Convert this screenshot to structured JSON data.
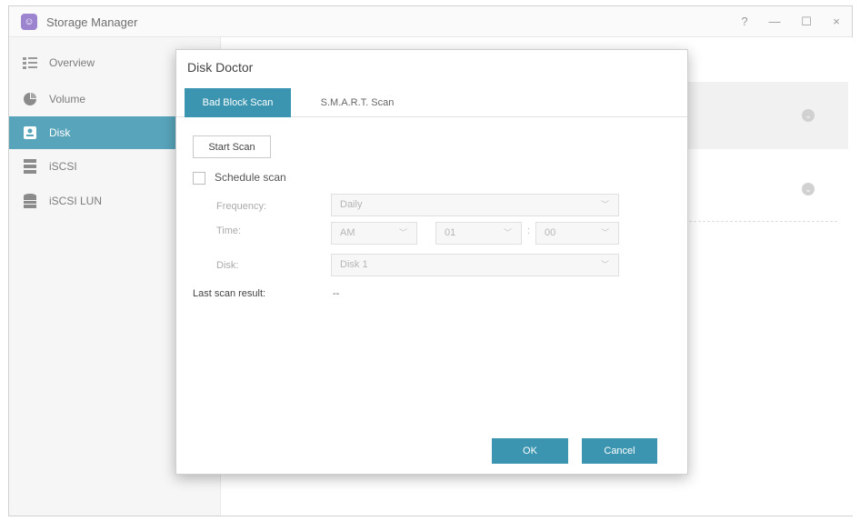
{
  "window": {
    "title": "Storage Manager",
    "app_icon": "storage-app-icon",
    "accent_color": "#3b95b0",
    "controls": {
      "help": "?",
      "minimize": "—",
      "maximize": "☐",
      "close": "×"
    }
  },
  "sidebar": {
    "items": [
      {
        "label": "Overview",
        "icon": "list-icon",
        "active": false
      },
      {
        "label": "Volume",
        "icon": "pie-chart-icon",
        "active": false
      },
      {
        "label": "Disk",
        "icon": "disk-icon",
        "active": true
      },
      {
        "label": "iSCSI",
        "icon": "server-icon",
        "active": false
      },
      {
        "label": "iSCSI LUN",
        "icon": "database-icon",
        "active": false
      }
    ]
  },
  "dialog": {
    "title": "Disk Doctor",
    "tabs": [
      {
        "label": "Bad Block Scan",
        "active": true
      },
      {
        "label": "S.M.A.R.T. Scan",
        "active": false
      }
    ],
    "start_scan_label": "Start Scan",
    "schedule": {
      "label": "Schedule scan",
      "checked": false
    },
    "frequency": {
      "label": "Frequency:",
      "value": "Daily"
    },
    "time": {
      "label": "Time:",
      "ampm": "AM",
      "hour": "01",
      "separator": ":",
      "minute": "00"
    },
    "disk": {
      "label": "Disk:",
      "value": "Disk 1"
    },
    "last_scan": {
      "label": "Last scan result:",
      "value": "--"
    },
    "ok_label": "OK",
    "cancel_label": "Cancel"
  }
}
